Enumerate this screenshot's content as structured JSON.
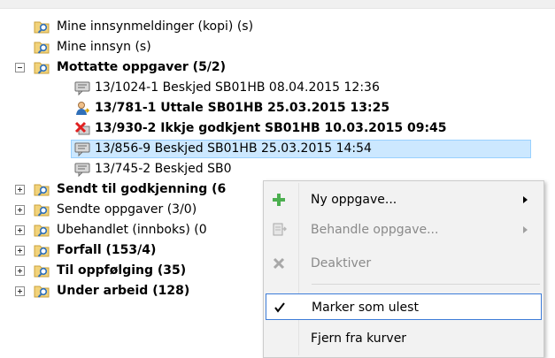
{
  "tree": {
    "items": [
      {
        "label": "Mine innsynmeldinger (kopi) (s)",
        "icon": "folder-search-icon"
      },
      {
        "label": "Mine innsyn (s)",
        "icon": "folder-search-icon"
      },
      {
        "label": "Mottatte oppgaver (5/2)",
        "icon": "folder-search-icon",
        "expanded": true
      },
      {
        "label": "13/1024-1 Beskjed SB01HB  08.04.2015 12:36",
        "icon": "message-icon"
      },
      {
        "label": "13/781-1 Uttale SB01HB 25.03.2015 13:25",
        "icon": "user-icon"
      },
      {
        "label": "13/930-2 Ikkje godkjent SB01HB 10.03.2015 09:45",
        "icon": "rejected-icon"
      },
      {
        "label": "13/856-9 Beskjed SB01HB 25.03.2015 14:54",
        "icon": "message-icon"
      },
      {
        "label": "13/745-2 Beskjed SB0",
        "icon": "message-icon"
      },
      {
        "label": "Sendt til godkjenning (6",
        "icon": "folder-search-icon"
      },
      {
        "label": "Sendte oppgaver (3/0)",
        "icon": "folder-search-icon"
      },
      {
        "label": "Ubehandlet (innboks) (0",
        "icon": "folder-search-icon"
      },
      {
        "label": "Forfall (153/4)",
        "icon": "folder-search-icon"
      },
      {
        "label": "Til oppfølging (35)",
        "icon": "folder-search-icon"
      },
      {
        "label": "Under arbeid (128)",
        "icon": "folder-search-icon"
      }
    ]
  },
  "context_menu": {
    "items": [
      {
        "label": "Ny oppgave...",
        "icon": "plus-icon",
        "enabled": true,
        "submenu": true
      },
      {
        "label": "Behandle oppgave...",
        "icon": "document-icon",
        "enabled": false,
        "submenu": true
      },
      {
        "label": "Deaktiver",
        "icon": "x-icon",
        "enabled": false
      },
      {
        "label": "Marker som ulest",
        "icon": "checkmark-icon",
        "enabled": true,
        "highlighted": true
      },
      {
        "label": "Fjern fra kurver",
        "enabled": true
      }
    ]
  },
  "colors": {
    "selection": "#cce8ff",
    "menu_highlight_border": "#3d7cd8",
    "rejected": "#e02020",
    "plus": "#4caf50"
  }
}
